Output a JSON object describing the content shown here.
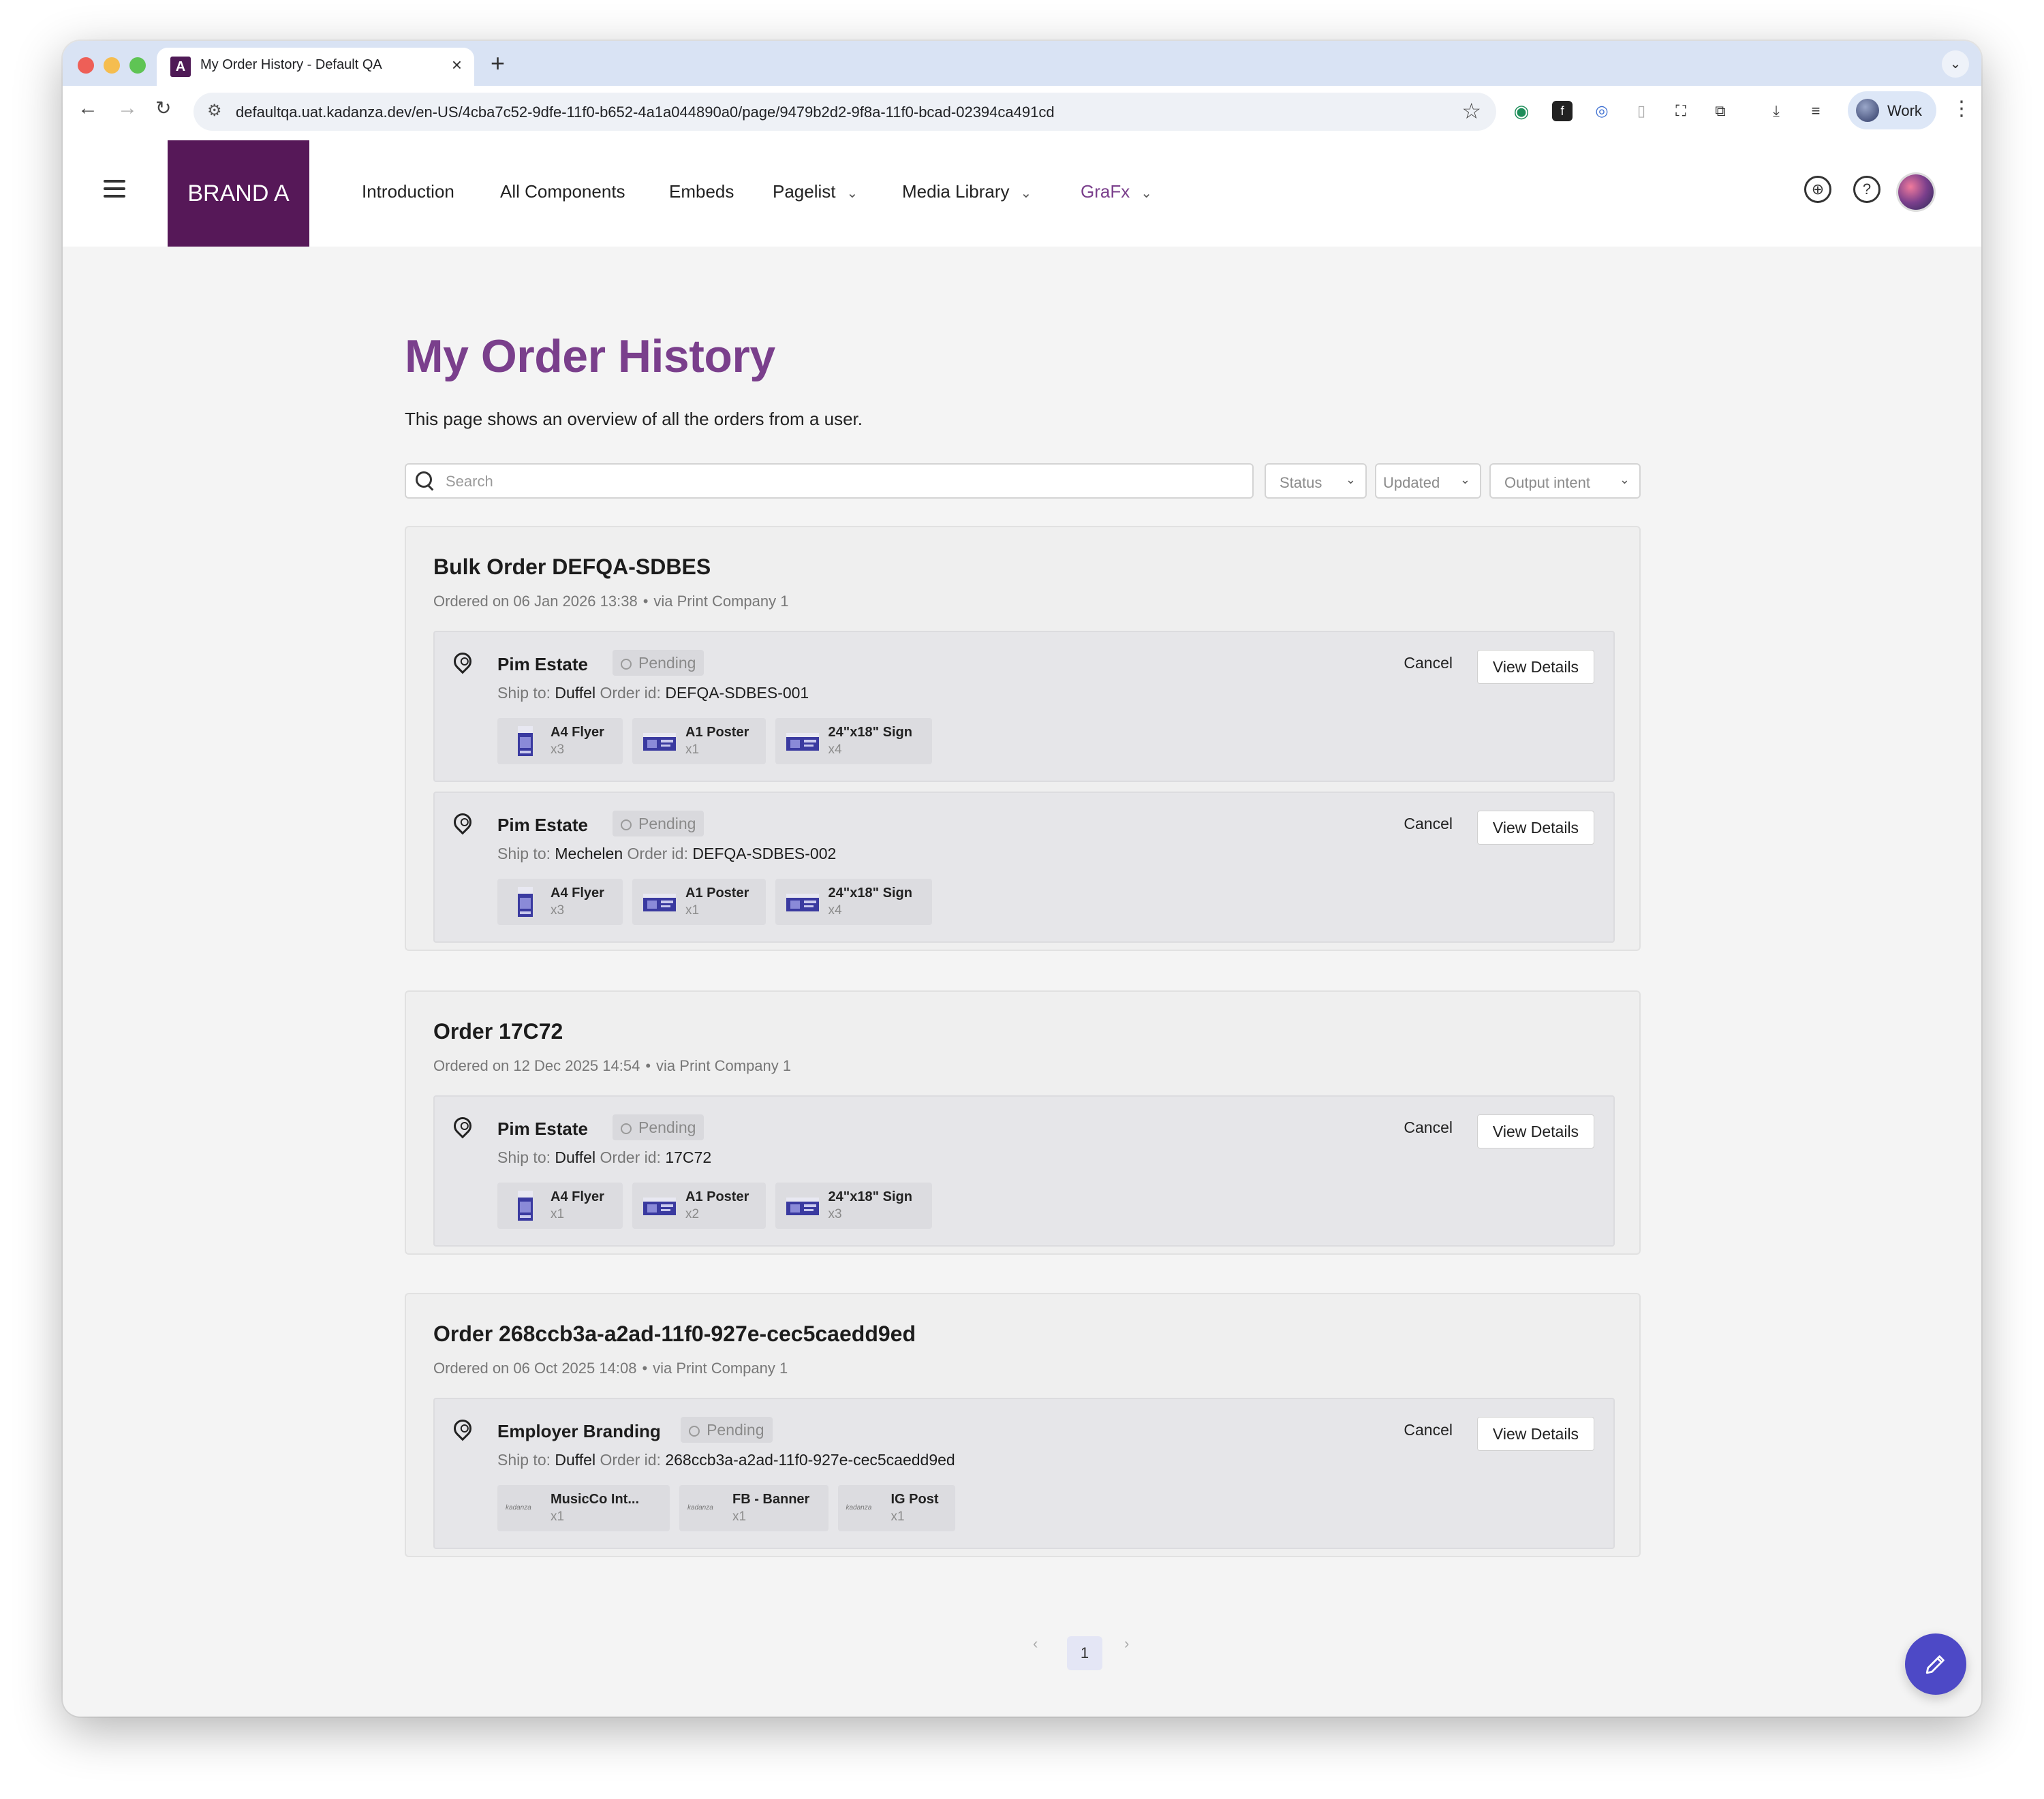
{
  "browser": {
    "tab_title": "My Order History - Default QA",
    "url": "defaultqa.uat.kadanza.dev/en-US/4cba7c52-9dfe-11f0-b652-4a1a044890a0/page/9479b2d2-9f8a-11f0-bcad-02394ca491cd",
    "profile_label": "Work",
    "colors": {
      "tabbar": "#d9e3f4",
      "close": "#ee5f57",
      "minimize": "#f5bd4f",
      "maximize": "#5fc454"
    }
  },
  "header": {
    "brand": "BRAND A",
    "brand_color": "#561858",
    "nav": [
      {
        "label": "Introduction"
      },
      {
        "label": "All Components"
      },
      {
        "label": "Embeds"
      },
      {
        "label": "Pagelist"
      },
      {
        "label": "Media Library"
      },
      {
        "label": "GraFx"
      }
    ],
    "icons": [
      "globe-icon",
      "help-icon",
      "user-avatar"
    ]
  },
  "page": {
    "title": "My Order History",
    "description": "This page shows an overview of all the orders from a user.",
    "accent_color": "#7a3f8c"
  },
  "filters": {
    "search_placeholder": "Search",
    "status": "Status",
    "updated": "Updated",
    "output_intent": "Output intent"
  },
  "orders": [
    {
      "title": "Bulk Order DEFQA-SDBES",
      "ordered_on": "Ordered on 06 Jan 2026 13:38",
      "via": "via Print Company 1",
      "shipments": [
        {
          "name": "Pim Estate",
          "status": "Pending",
          "ship_to_label": "Ship to:",
          "ship_to": "Duffel",
          "order_id_label": "Order id:",
          "order_id": "DEFQA-SDBES-001",
          "items": [
            {
              "name": "A4 Flyer",
              "qty": "x3"
            },
            {
              "name": "A1 Poster",
              "qty": "x1"
            },
            {
              "name": "24\"x18\" Sign",
              "qty": "x4"
            }
          ]
        },
        {
          "name": "Pim Estate",
          "status": "Pending",
          "ship_to_label": "Ship to:",
          "ship_to": "Mechelen",
          "order_id_label": "Order id:",
          "order_id": "DEFQA-SDBES-002",
          "items": [
            {
              "name": "A4 Flyer",
              "qty": "x3"
            },
            {
              "name": "A1 Poster",
              "qty": "x1"
            },
            {
              "name": "24\"x18\" Sign",
              "qty": "x4"
            }
          ]
        }
      ]
    },
    {
      "title": "Order 17C72",
      "ordered_on": "Ordered on 12 Dec 2025 14:54",
      "via": "via Print Company 1",
      "shipments": [
        {
          "name": "Pim Estate",
          "status": "Pending",
          "ship_to_label": "Ship to:",
          "ship_to": "Duffel",
          "order_id_label": "Order id:",
          "order_id": "17C72",
          "items": [
            {
              "name": "A4 Flyer",
              "qty": "x1"
            },
            {
              "name": "A1 Poster",
              "qty": "x2"
            },
            {
              "name": "24\"x18\" Sign",
              "qty": "x3"
            }
          ]
        }
      ]
    },
    {
      "title": "Order 268ccb3a-a2ad-11f0-927e-cec5caedd9ed",
      "ordered_on": "Ordered on 06 Oct 2025 14:08",
      "via": "via Print Company 1",
      "shipments": [
        {
          "name": "Employer Branding",
          "status": "Pending",
          "ship_to_label": "Ship to:",
          "ship_to": "Duffel",
          "order_id_label": "Order id:",
          "order_id": "268ccb3a-a2ad-11f0-927e-cec5caedd9ed",
          "items": [
            {
              "name": "MusicCo Int...",
              "qty": "x1"
            },
            {
              "name": "FB - Banner",
              "qty": "x1"
            },
            {
              "name": "IG Post",
              "qty": "x1"
            }
          ]
        }
      ]
    }
  ],
  "actions": {
    "cancel": "Cancel",
    "view_details": "View Details"
  },
  "thumb_logo_text": "kadanza",
  "pagination": {
    "prev": "‹",
    "current": "1",
    "next": "›"
  },
  "fab_icon": "edit-pencil-icon"
}
